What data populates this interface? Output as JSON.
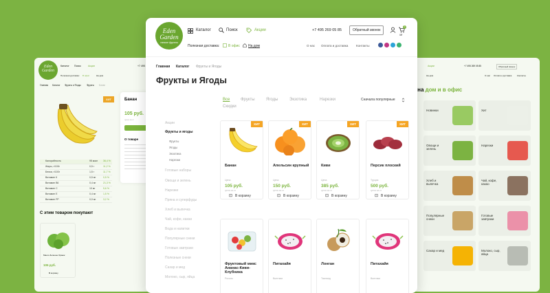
{
  "brand": {
    "line1": "Eden",
    "line2": "Garden",
    "tag": "свежие фрукты"
  },
  "header": {
    "catalog": "Каталог",
    "search": "Поиск",
    "promo": "Акции",
    "phone": "+7 495 269 05 85",
    "callback": "Обратный звонок",
    "cart_count": "3",
    "cart_sum": "0₽"
  },
  "delivery": {
    "label": "Полезная доставка:",
    "office": "В офис",
    "home": "На дом"
  },
  "nav": {
    "about": "О нас",
    "payment": "Оплата и доставка",
    "contacts": "Контакты"
  },
  "social_colors": [
    "#3b5998",
    "#c13584",
    "#2aa3d8",
    "#3cb371"
  ],
  "breadcrumb": {
    "home": "Главная",
    "catalog": "Каталог",
    "current": "Фрукты и Ягоды"
  },
  "page_title": "Фрукты и Ягоды",
  "tabs": [
    "Все",
    "Фрукты",
    "Ягоды",
    "Экзотика",
    "Нарезки",
    "Скидки"
  ],
  "sort": "Сначала популярные",
  "sidebar": {
    "items": [
      "Акции",
      "Фрукты и ягоды",
      "Готовые наборы",
      "Овощи и зелень",
      "Нарезки",
      "Пряна и суперфуды",
      "Хлеб и выпечка",
      "Чай, кофе, какао",
      "Вода и напитки",
      "Популярные снеки",
      "Готовые завтраки",
      "Полезные снеки",
      "Сахар и мед",
      "Молоко, сыр, яйца"
    ],
    "subs": [
      "Фрукты",
      "Ягоды",
      "Экзотика",
      "Нарезки"
    ]
  },
  "products": [
    {
      "name": "Банан",
      "label": "Цена",
      "price": "105 руб.",
      "unit": "цена за кг",
      "hit": "ХИТ",
      "cart": "В корзину"
    },
    {
      "name": "Апельсин крупный",
      "label": "Цена",
      "price": "150 руб.",
      "unit": "цена за кг",
      "hit": "ХИТ",
      "cart": "В корзину"
    },
    {
      "name": "Киви",
      "label": "Цена",
      "price": "385 руб.",
      "unit": "цена за кг",
      "hit": "ХИТ",
      "cart": "В корзину"
    },
    {
      "name": "Персик плоский",
      "label": "Турция",
      "price": "500 руб.",
      "unit": "цена за кг",
      "hit": "ХИТ",
      "cart": "В корзину"
    },
    {
      "name": "Фруктовый микс Ананас-Киви-Клубника",
      "label": "Россия",
      "price": "",
      "unit": "",
      "hit": "",
      "cart": ""
    },
    {
      "name": "Питахайя",
      "label": "Вьетнам",
      "price": "",
      "unit": "",
      "hit": "",
      "cart": ""
    },
    {
      "name": "Лонган",
      "label": "Таиланд",
      "price": "",
      "unit": "",
      "hit": "",
      "cart": ""
    },
    {
      "name": "Питахайя",
      "label": "Вьетнам",
      "price": "",
      "unit": "",
      "hit": "",
      "cart": ""
    }
  ],
  "left_page": {
    "breadcrumb": [
      "Главная",
      "Каталог",
      "Фрукты и Ягоды",
      "Фрукты",
      "Банан"
    ],
    "product": "Банан",
    "price": "105 руб.",
    "unit": "цена за кг",
    "hit": "ХИТ",
    "about": "О товаре",
    "rows": [
      [
        "Калорийность",
        "95 ккал",
        "36,4 %"
      ],
      [
        "Жиры, г/100г",
        "0,5 г",
        "11,2 %"
      ],
      [
        "Белки, г/100г",
        "1,5 г",
        "11,7 %"
      ],
      [
        "Витамин К",
        "0,5 мг",
        "0,5 %"
      ],
      [
        "Витамин В6",
        "0,4 мг",
        "21,3 %"
      ],
      [
        "Витамин С",
        "10 мг",
        "5,6 %"
      ],
      [
        "Витамин Е",
        "0,4 мг",
        "1,5 %"
      ],
      [
        "Витамин РР",
        "0,9 мг",
        "3,2 %"
      ]
    ],
    "also": "С этим товаром покупают",
    "also_item": "Манго Зеленое Оранж",
    "also_price": "105 руб.",
    "cart": "В корзину"
  },
  "right_page": {
    "phone": "+7 495 269 05 85",
    "callback": "Обратный звонок",
    "heading_pre": "в на",
    "heading_link": "дом и в офис",
    "tiles": [
      "Новинки",
      "Хит",
      "Овощи и зелень",
      "Нарезки",
      "Хлеб и выпечка",
      "Чай, кофе, какао",
      "Популярные снеки",
      "Готовые завтраки",
      "Сахар и мед",
      "Молоко, сыр, яйца"
    ]
  }
}
